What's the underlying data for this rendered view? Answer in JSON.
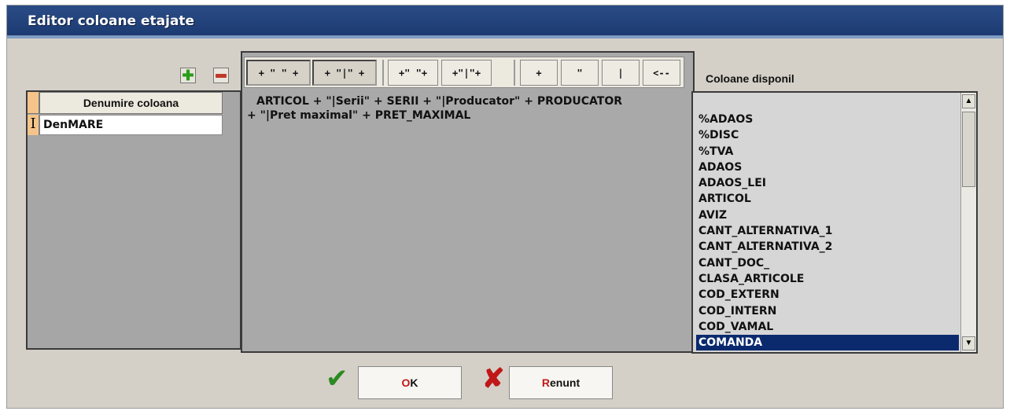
{
  "window": {
    "title": "Editor coloane etajate"
  },
  "left_grid": {
    "header": "Denumire coloana",
    "rows": [
      {
        "indicator": "I",
        "value": "DenMARE"
      }
    ]
  },
  "toolbar": {
    "buttons": [
      {
        "name": "plus-space-plus",
        "label": "+ \" \" +"
      },
      {
        "name": "plus-pipe-plus",
        "label": "+ \"|\" +"
      },
      {
        "name": "plus-quote-plus",
        "label": "+\" \"+"
      },
      {
        "name": "plus-quote-pipe-plus",
        "label": "+\"|\"+"
      },
      {
        "name": "plus",
        "label": "+"
      },
      {
        "name": "quote",
        "label": "\""
      },
      {
        "name": "pipe",
        "label": "|"
      },
      {
        "name": "backspace",
        "label": "<--"
      }
    ]
  },
  "formula": {
    "line1": "ARTICOL + \"|Serii\" + SERII + \"|Producator\" + PRODUCATOR",
    "line2": "+ \"|Pret maximal\" + PRET_MAXIMAL"
  },
  "available": {
    "label": "Coloane disponil",
    "items": [
      "%ADAOS",
      "%DISC",
      "%TVA",
      "ADAOS",
      "ADAOS_LEI",
      "ARTICOL",
      "AVIZ",
      "CANT_ALTERNATIVA_1",
      "CANT_ALTERNATIVA_2",
      "CANT_DOC_",
      "CLASA_ARTICOLE",
      "COD_EXTERN",
      "COD_INTERN",
      "COD_VAMAL",
      "COMANDA"
    ],
    "selected": "COMANDA"
  },
  "buttons": {
    "ok_accel": "O",
    "ok_rest": "K",
    "cancel_accel": "R",
    "cancel_rest": "enunt"
  },
  "icons": {
    "add": "plus-icon",
    "remove": "minus-icon",
    "ok": "checkmark-icon",
    "cancel": "x-icon"
  },
  "colors": {
    "titlebar": "#1d3a72",
    "selection": "#0b2a6e",
    "check": "#2b8a20",
    "cross": "#c01818"
  }
}
